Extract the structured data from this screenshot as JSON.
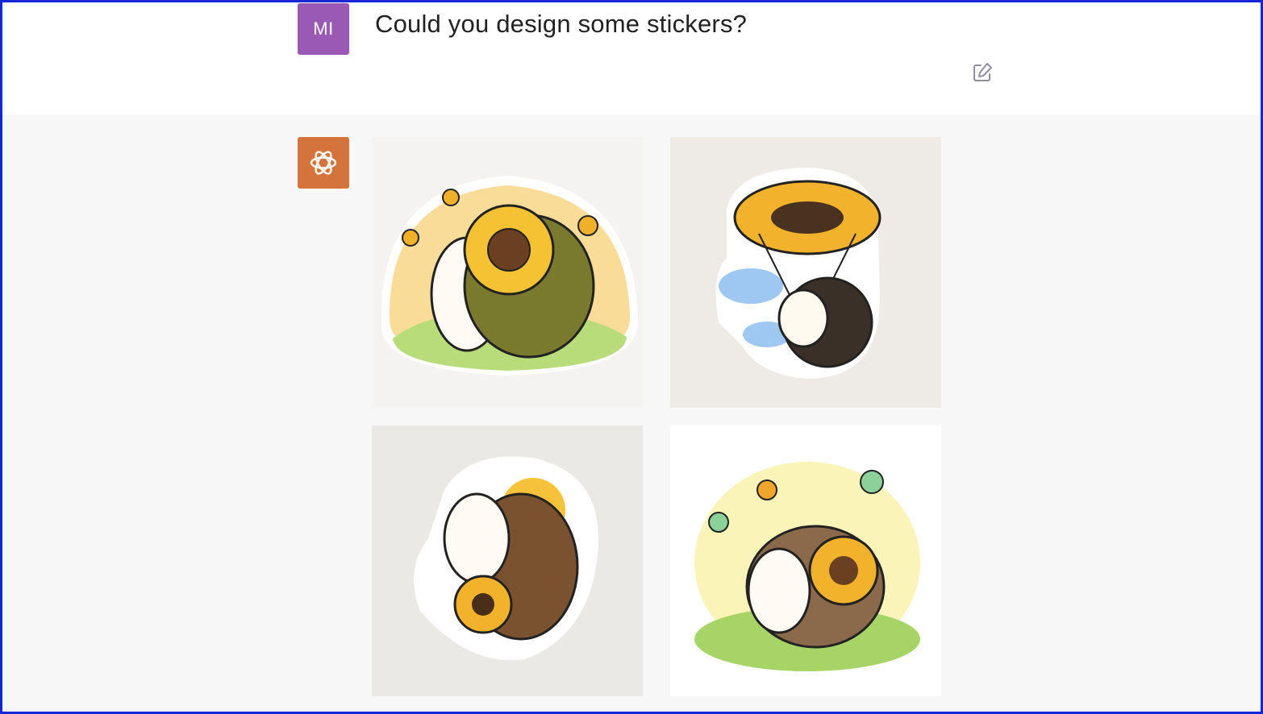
{
  "user_message": {
    "avatar_initials": "MI",
    "text": "Could you design some stickers?"
  },
  "assistant": {
    "avatar_icon": "openai-logo-icon"
  },
  "images": [
    {
      "name": "sticker-hedgehog-sunflower-butterflies",
      "bg": "#f4f3f1"
    },
    {
      "name": "sticker-hedgehog-sunflower-parachute",
      "bg": "#eeebe7"
    },
    {
      "name": "sticker-hedgehog-sun-dancing",
      "bg": "#ebe9e6"
    },
    {
      "name": "sticker-hedgehog-sunflower-meadow",
      "bg": "#ffffff"
    }
  ],
  "colors": {
    "user_avatar": "#9b59b6",
    "assistant_avatar": "#d4733b",
    "assistant_row_bg": "#f7f7f8",
    "frame": "#1428d8"
  }
}
